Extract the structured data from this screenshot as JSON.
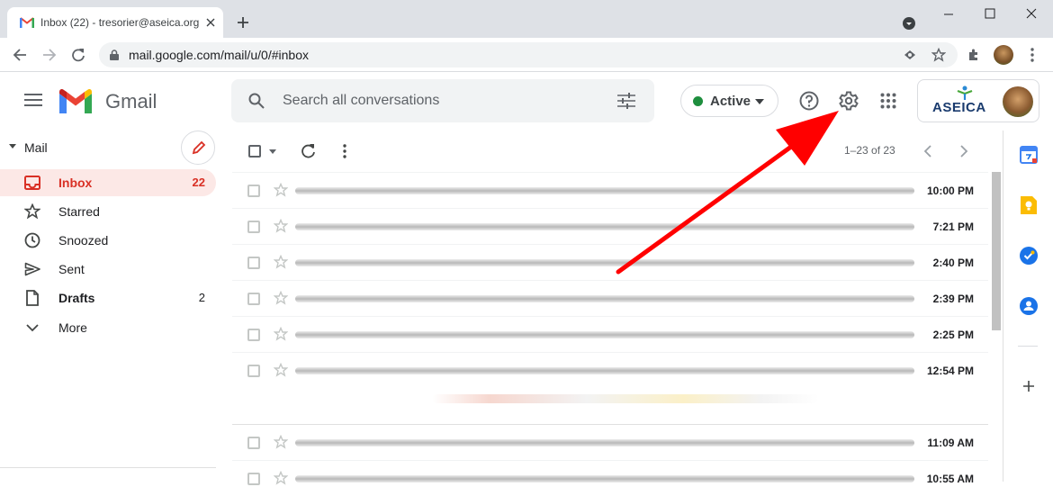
{
  "browser": {
    "tab_title": "Inbox (22) - tresorier@aseica.org",
    "url": "mail.google.com/mail/u/0/#inbox"
  },
  "gmail": {
    "product_name": "Gmail",
    "search_placeholder": "Search all conversations",
    "status": "Active",
    "status_color": "#1e8e3e",
    "org_name": "ASEICA"
  },
  "sidebar": {
    "section_label": "Mail",
    "items": [
      {
        "label": "Inbox",
        "count": "22",
        "icon": "inbox-icon"
      },
      {
        "label": "Starred",
        "count": "",
        "icon": "star-icon"
      },
      {
        "label": "Snoozed",
        "count": "",
        "icon": "clock-icon"
      },
      {
        "label": "Sent",
        "count": "",
        "icon": "send-icon"
      },
      {
        "label": "Drafts",
        "count": "2",
        "icon": "draft-icon"
      },
      {
        "label": "More",
        "count": "",
        "icon": "chevron-down-icon"
      }
    ]
  },
  "list": {
    "range": "1–23 of 23",
    "rows": [
      {
        "time": "10:00 PM"
      },
      {
        "time": "7:21 PM"
      },
      {
        "time": "2:40 PM"
      },
      {
        "time": "2:39 PM"
      },
      {
        "time": "2:25 PM"
      },
      {
        "time": "12:54 PM"
      },
      {
        "time": "11:09 AM"
      },
      {
        "time": "10:55 AM"
      }
    ]
  },
  "colors": {
    "accent_red": "#d93025",
    "annotation_arrow": "#ff0000"
  }
}
